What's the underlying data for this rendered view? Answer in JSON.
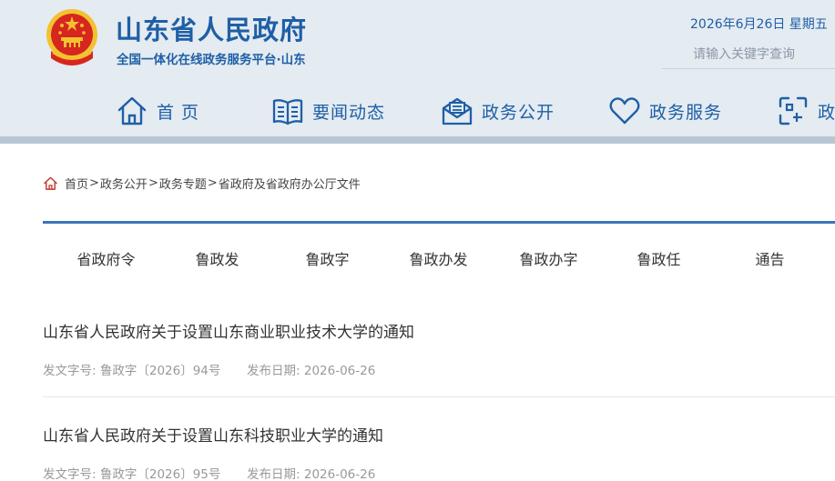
{
  "header": {
    "title": "山东省人民政府",
    "subtitle": "全国一体化在线政务服务平台·山东",
    "date": "2026年6月26日 星期五",
    "search_placeholder": "请输入关键字查询",
    "nav": [
      {
        "label": "首 页",
        "icon": "home-icon"
      },
      {
        "label": "要闻动态",
        "icon": "book-icon"
      },
      {
        "label": "政务公开",
        "icon": "mail-icon"
      },
      {
        "label": "政务服务",
        "icon": "heart-icon"
      },
      {
        "label": "政",
        "icon": "grid-icon"
      }
    ]
  },
  "breadcrumb": {
    "icon": "home-icon",
    "items": [
      "首页",
      "政务公开",
      "政务专题",
      "省政府及省政府办公厅文件"
    ],
    "separator": ">"
  },
  "tabs": [
    "省政府令",
    "鲁政发",
    "鲁政字",
    "鲁政办发",
    "鲁政办字",
    "鲁政任",
    "通告"
  ],
  "documents": [
    {
      "title": "山东省人民政府关于设置山东商业职业技术大学的通知",
      "doc_no_label": "发文字号:",
      "doc_no": "鲁政字〔2026〕94号",
      "date_label": "发布日期:",
      "date": "2026-06-26"
    },
    {
      "title": "山东省人民政府关于设置山东科技职业大学的通知",
      "doc_no_label": "发文字号:",
      "doc_no": "鲁政字〔2026〕95号",
      "date_label": "发布日期:",
      "date": "2026-06-26"
    }
  ],
  "colors": {
    "brand_blue": "#1f5fa6",
    "header_bg": "#e4ebf1",
    "header_bar": "#b8c6d3",
    "divider_blue": "#3a76b8",
    "emblem_red": "#d7261e",
    "emblem_gold": "#f2c230"
  }
}
